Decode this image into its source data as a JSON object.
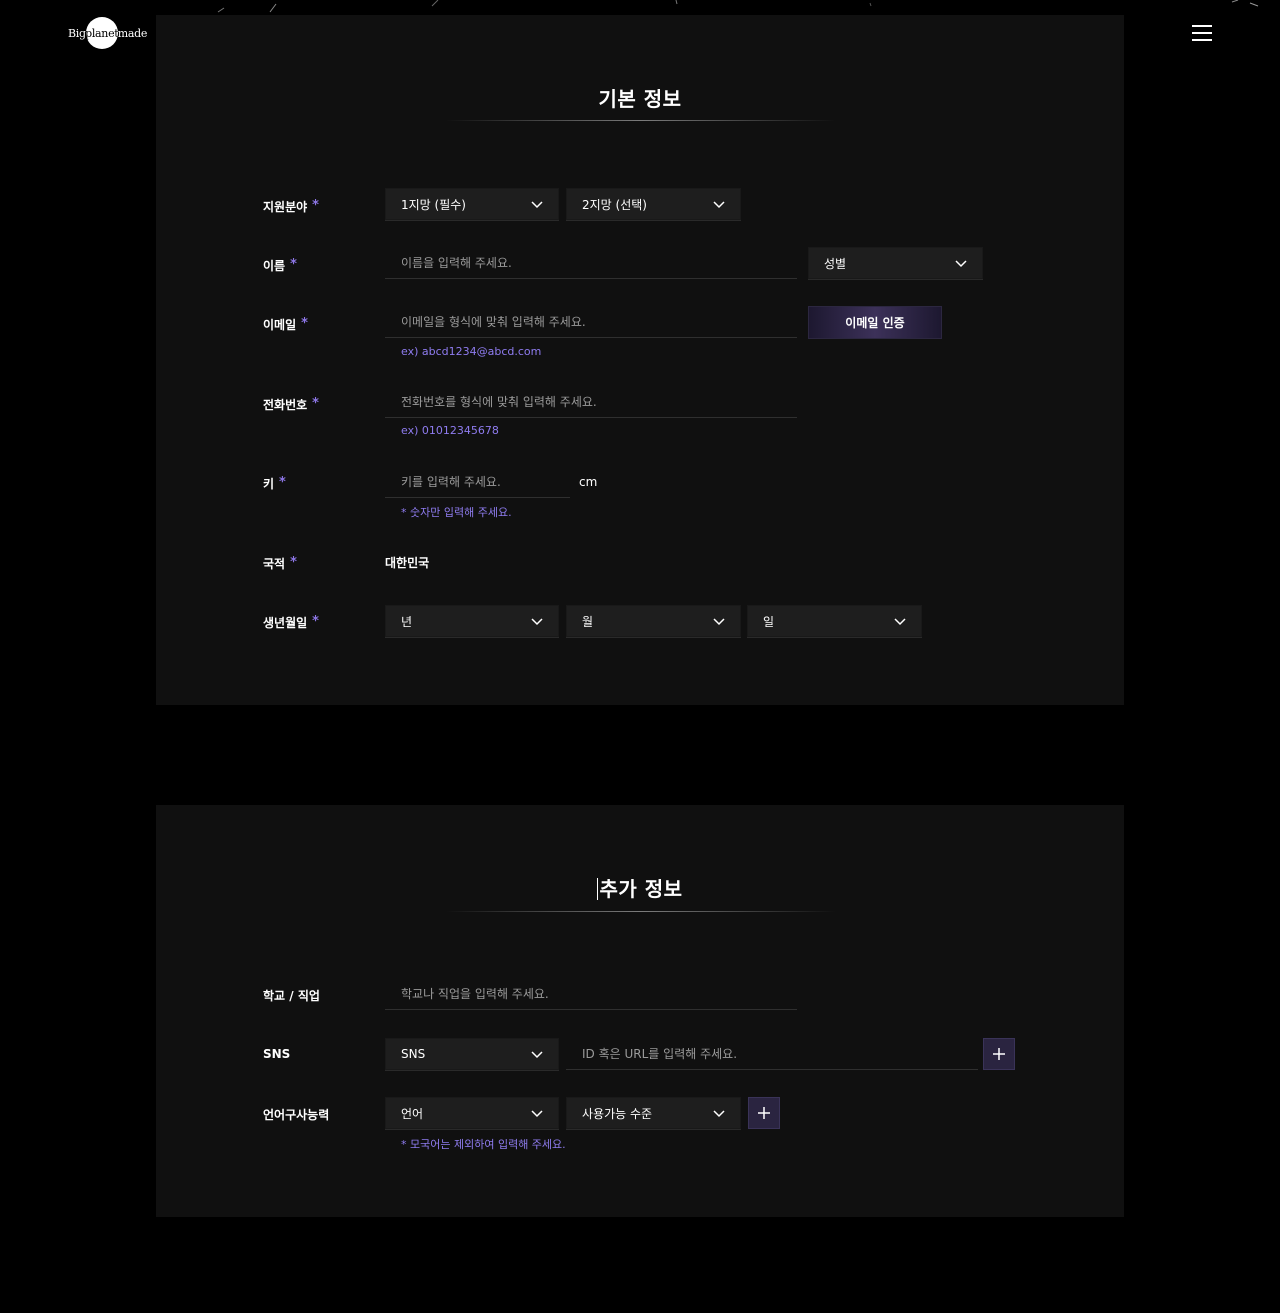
{
  "header": {
    "logo": {
      "big": "Big",
      "planet": "planet",
      "made": "made"
    },
    "menu_icon": "hamburger-menu-icon"
  },
  "basic": {
    "title": "기본 정보",
    "field": {
      "label": "지원분야",
      "required": "*",
      "first": "1지망 (필수)",
      "second": "2지망 (선택)"
    },
    "name": {
      "label": "이름",
      "required": "*",
      "placeholder": "이름을 입력해 주세요.",
      "gender": "성별"
    },
    "email": {
      "label": "이메일",
      "required": "*",
      "placeholder": "이메일을 형식에 맞춰 입력해 주세요.",
      "verify_button": "이메일 인증",
      "hint": "ex) abcd1234@abcd.com"
    },
    "phone": {
      "label": "전화번호",
      "required": "*",
      "placeholder": "전화번호를 형식에 맞춰 입력해 주세요.",
      "hint": "ex) 01012345678"
    },
    "height": {
      "label": "키",
      "required": "*",
      "placeholder": "키를 입력해 주세요.",
      "unit": "cm",
      "hint": "* 숫자만 입력해 주세요."
    },
    "nationality": {
      "label": "국적",
      "required": "*",
      "value": "대한민국"
    },
    "birth": {
      "label": "생년월일",
      "required": "*",
      "year": "년",
      "month": "월",
      "day": "일"
    }
  },
  "extra": {
    "title": "추가 정보",
    "school": {
      "label": "학교 / 직업",
      "placeholder": "학교나 직업을 입력해 주세요."
    },
    "sns": {
      "label": "SNS",
      "select": "SNS",
      "placeholder": "ID 혹은 URL를 입력해 주세요."
    },
    "language": {
      "label": "언어구사능력",
      "select": "언어",
      "level": "사용가능 수준",
      "hint": "* 모국어는 제외하여 입력해 주세요."
    }
  },
  "colors": {
    "accent": "#8f7cf0",
    "panel": "#101010",
    "field": "#1e1e1e"
  }
}
